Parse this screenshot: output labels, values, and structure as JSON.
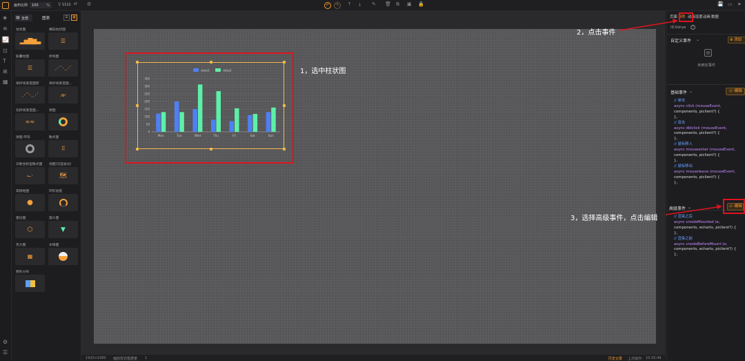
{
  "topbar": {
    "logo_icon": "dataview-logo-icon",
    "scale_label": "画布比例",
    "scale_value": "100",
    "scale_unit": "%",
    "gear_text": "1111"
  },
  "toolstrip": {
    "icons": [
      "layers-icon",
      "stack-icon",
      "chart-icon",
      "image-icon",
      "text-icon",
      "table-icon",
      "grid-icon",
      "settings-icon",
      "sliders-icon"
    ]
  },
  "sidebar": {
    "filter_all": "全部",
    "header_title": "图表",
    "items": [
      {
        "label": "柱状图",
        "glyph": "bars"
      },
      {
        "label": "横向柱状图",
        "glyph": "hbars"
      },
      {
        "label": "胶囊柱图",
        "glyph": "hbars"
      },
      {
        "label": "折线图",
        "glyph": "line"
      },
      {
        "label": "单折线渐变面积",
        "glyph": "line"
      },
      {
        "label": "单折线渐变面...",
        "glyph": "area"
      },
      {
        "label": "双折线渐变面...",
        "glyph": "area2"
      },
      {
        "label": "饼图",
        "glyph": "donut"
      },
      {
        "label": "饼图-环形",
        "glyph": "ring"
      },
      {
        "label": "散点图",
        "glyph": "scatter"
      },
      {
        "label": "对数坐标型散点图",
        "glyph": "log"
      },
      {
        "label": "地图(可选省份)",
        "glyph": "map"
      },
      {
        "label": "高德地图",
        "glyph": "pin"
      },
      {
        "label": "环形进度",
        "glyph": "gauge"
      },
      {
        "label": "雷达图",
        "glyph": "radar"
      },
      {
        "label": "漏斗图",
        "glyph": "funnel"
      },
      {
        "label": "热力图",
        "glyph": "heat"
      },
      {
        "label": "水球图",
        "glyph": "water"
      },
      {
        "label": "矩形分布",
        "glyph": "tree"
      }
    ]
  },
  "right_panel": {
    "tabs": [
      "页面",
      "事件",
      "动画设置",
      "动画",
      "数据"
    ],
    "active_tab": "事件",
    "component_id": "ID:0xhye",
    "custom_events_label": "自定义事件",
    "add_button": "添加",
    "no_events": "未绑定事件",
    "basic_events_label": "基础事件",
    "edit_button": "编辑",
    "basic_code": [
      "// 单击",
      "async click (mouseEvent,",
      "components, piclient?) {",
      "},",
      "// 双击",
      "async dblclick (mouseEvent,",
      "components, piclient?) {",
      "},",
      "// 鼠标移入",
      "async mouseenter (mouseEvent,",
      "components, piclient?) {",
      "},",
      "// 鼠标移出",
      "async mouseleave (mouseEvent,",
      "components, piclient?) {",
      "},"
    ],
    "advanced_events_label": "高级事件",
    "advanced_code": [
      "// 渲染之后",
      "async vnodeMounted (e,",
      "components, echarts, piclient?) {",
      "},",
      "// 渲染之前",
      "async vnodeBeforeMount (e,",
      "components, echarts, piclient?) {",
      "},"
    ]
  },
  "annotations": {
    "step1": "1，选中柱状图",
    "step2": "2，点击事件",
    "step3": "3，选择高级事件，点击编辑"
  },
  "status": {
    "resolution": "1920×1080",
    "mode": "缩放样式根据宽",
    "zoom": "1",
    "save_label": "历史记录",
    "last_op": "上次操作:",
    "time": "10:35:49"
  },
  "chart_data": {
    "type": "bar",
    "categories": [
      "Mon",
      "Tue",
      "Wed",
      "Thu",
      "Fri",
      "Sat",
      "Sun"
    ],
    "series": [
      {
        "name": "data1",
        "color": "#4e80f5",
        "values": [
          120,
          200,
          150,
          80,
          70,
          110,
          130
        ]
      },
      {
        "name": "data2",
        "color": "#5df0a8",
        "values": [
          130,
          130,
          312,
          268,
          155,
          118,
          160
        ]
      }
    ],
    "yticks": [
      0,
      50,
      100,
      150,
      200,
      250,
      300,
      350
    ],
    "ylim": [
      0,
      350
    ]
  }
}
